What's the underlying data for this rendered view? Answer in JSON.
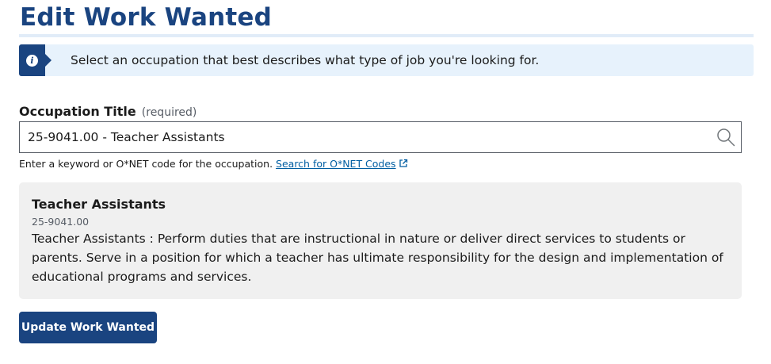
{
  "page": {
    "title": "Edit Work Wanted"
  },
  "alert": {
    "icon": "info-icon",
    "message": "Select an occupation that best describes what type of job you're looking for."
  },
  "occupation_field": {
    "label": "Occupation Title",
    "required_text": "(required)",
    "value": "25-9041.00 - Teacher Assistants",
    "search_icon": "search-icon",
    "hint_text": "Enter a keyword or O*NET code for the occupation.",
    "hint_link": "Search for O*NET Codes",
    "hint_link_icon": "external-link-icon"
  },
  "occupation_card": {
    "title": "Teacher Assistants",
    "code": "25-9041.00",
    "description": "Teacher Assistants : Perform duties that are instructional in nature or deliver direct services to students or parents. Serve in a position for which a teacher has ultimate responsibility for the design and implementation of educational programs and services."
  },
  "actions": {
    "update_label": "Update Work Wanted"
  },
  "colors": {
    "primary": "#1a4480",
    "alert_bg": "#e7f2fc",
    "link": "#005ea2",
    "card_bg": "#f0f0f0"
  }
}
